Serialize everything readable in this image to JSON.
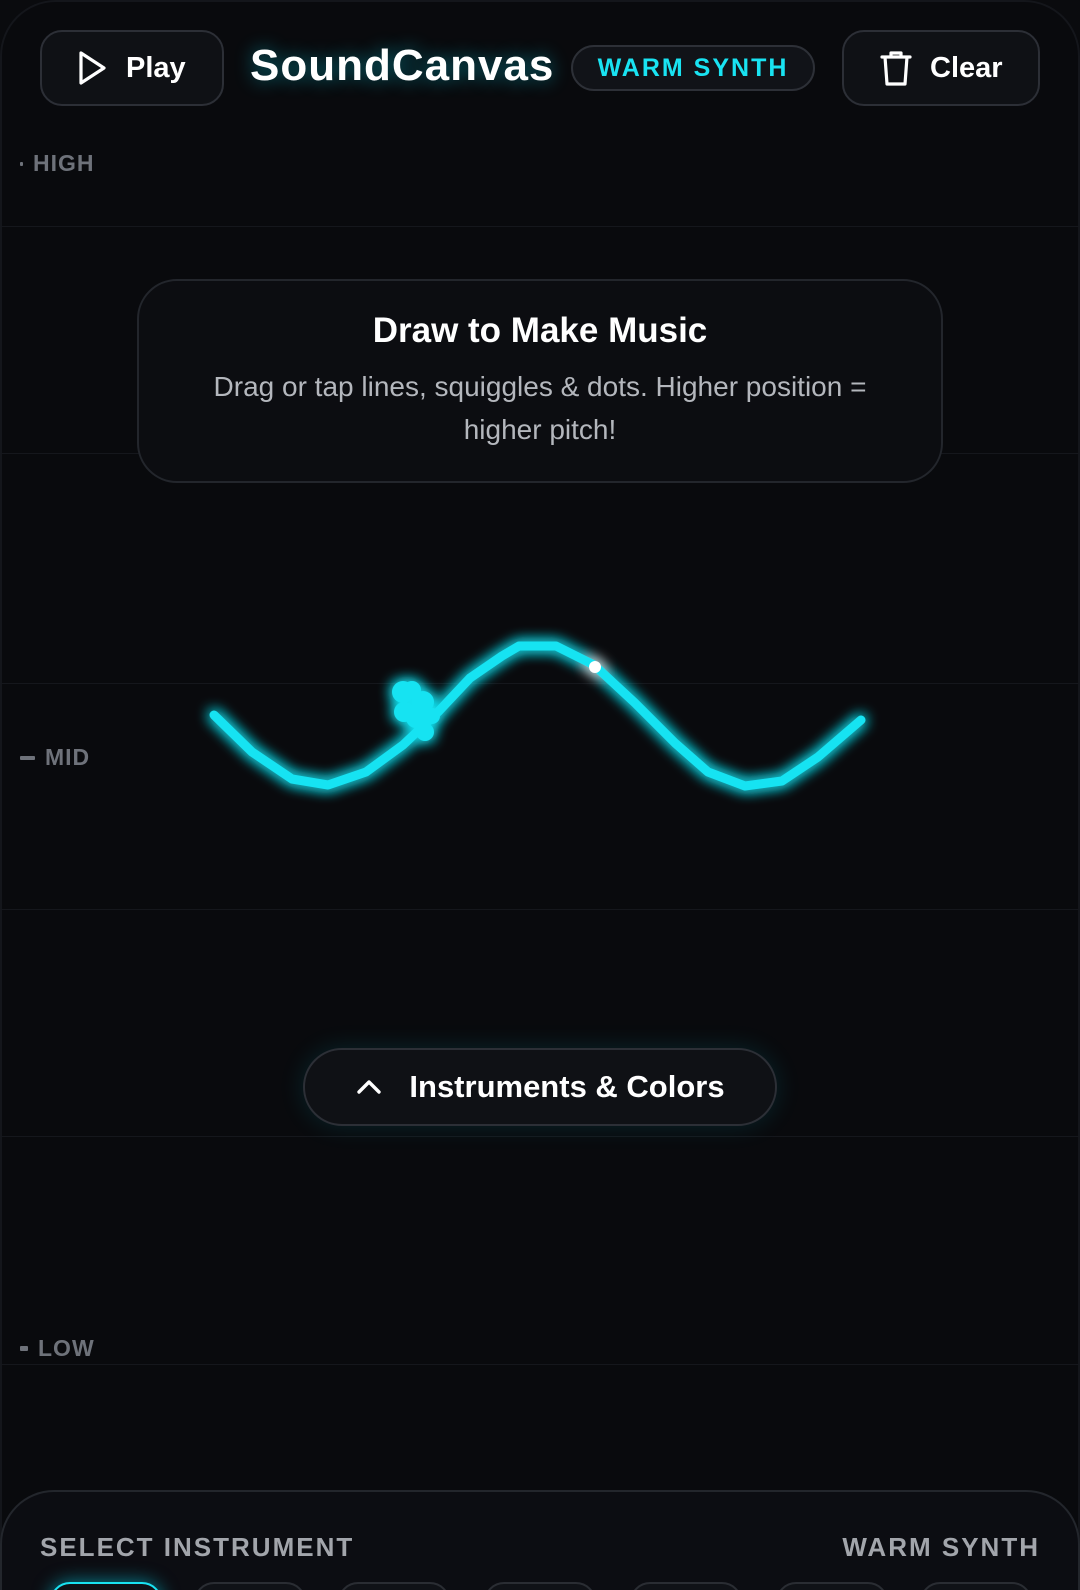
{
  "header": {
    "play_label": "Play",
    "title": "SoundCanvas",
    "instrument_badge": "WARM SYNTH",
    "clear_label": "Clear"
  },
  "pitch_axis": {
    "high": "HIGH",
    "mid": "MID",
    "low": "LOW"
  },
  "intro_card": {
    "title": "Draw to Make Music",
    "text": "Drag or tap lines, squiggles & dots. Higher position = higher pitch!"
  },
  "instruments_toggle": {
    "label": "Instruments & Colors",
    "icon": "chevron-up-icon"
  },
  "instrument_panel": {
    "title": "SELECT INSTRUMENT",
    "selected": "WARM SYNTH"
  },
  "colors": {
    "stroke": "#19e3f2",
    "accent": "#19e3f2",
    "background": "#090a0d"
  }
}
